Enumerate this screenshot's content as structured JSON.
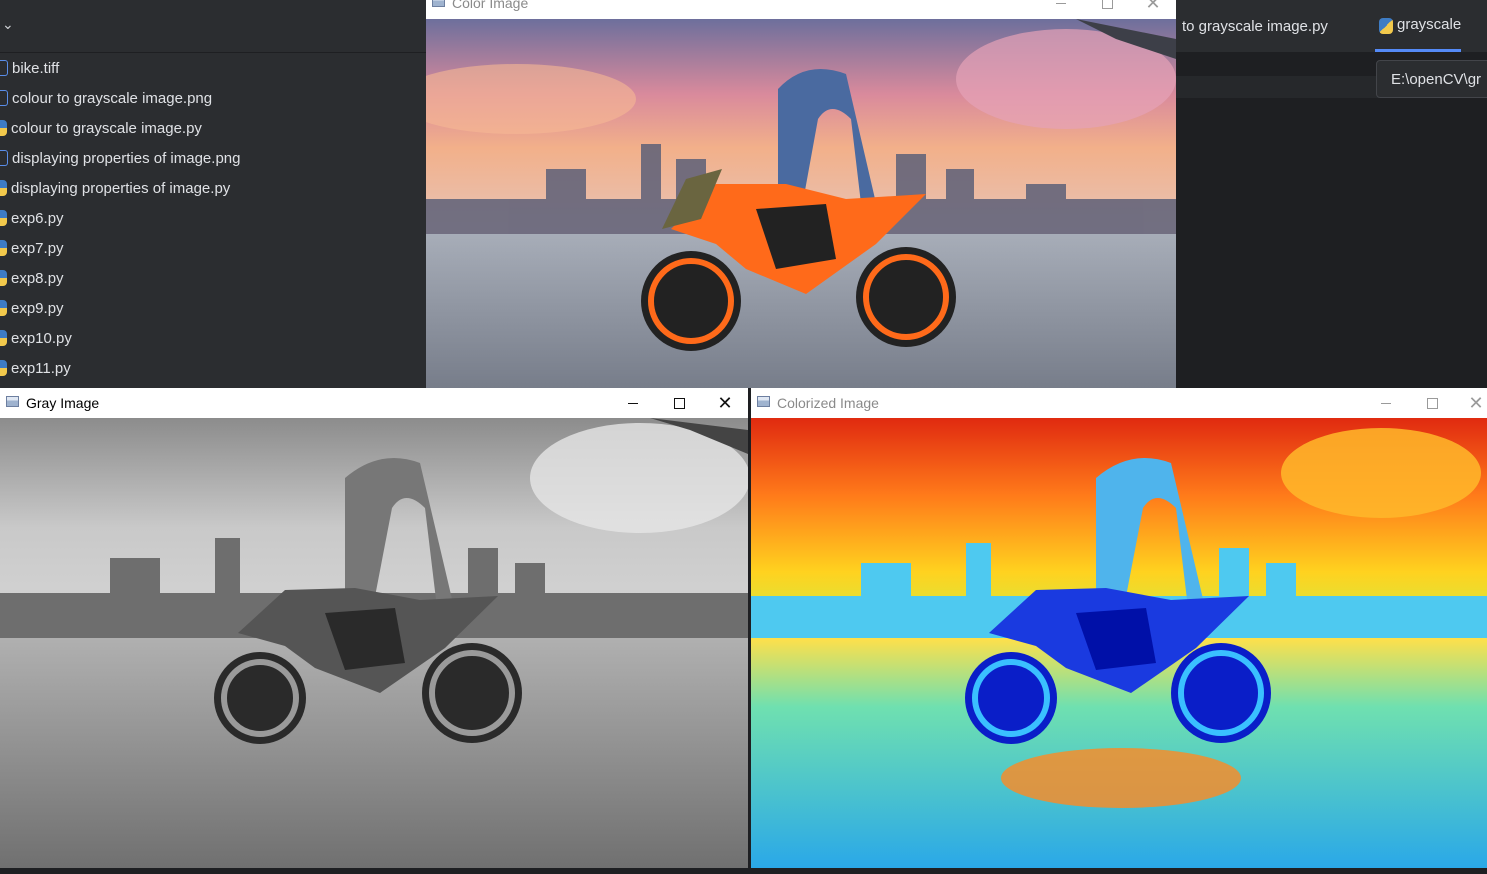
{
  "ide": {
    "files": [
      {
        "name": "bike.tiff",
        "type": "image"
      },
      {
        "name": "colour to grayscale image.png",
        "type": "image"
      },
      {
        "name": "colour to grayscale image.py",
        "type": "python"
      },
      {
        "name": "displaying properties of image.png",
        "type": "image"
      },
      {
        "name": "displaying properties of image.py",
        "type": "python"
      },
      {
        "name": "exp6.py",
        "type": "python"
      },
      {
        "name": "exp7.py",
        "type": "python"
      },
      {
        "name": "exp8.py",
        "type": "python"
      },
      {
        "name": "exp9.py",
        "type": "python"
      },
      {
        "name": "exp10.py",
        "type": "python"
      },
      {
        "name": "exp11.py",
        "type": "python"
      }
    ],
    "tabs": {
      "partial_tab": "to grayscale image.py",
      "active_tab": "grayscale"
    },
    "tooltip": "E:\\openCV\\gr"
  },
  "windows": {
    "color": {
      "title": "Color Image"
    },
    "gray": {
      "title": "Gray Image"
    },
    "colorized": {
      "title": "Colorized Image"
    }
  },
  "colors": {
    "ide_bg": "#2b2d30",
    "accent": "#548af7"
  }
}
